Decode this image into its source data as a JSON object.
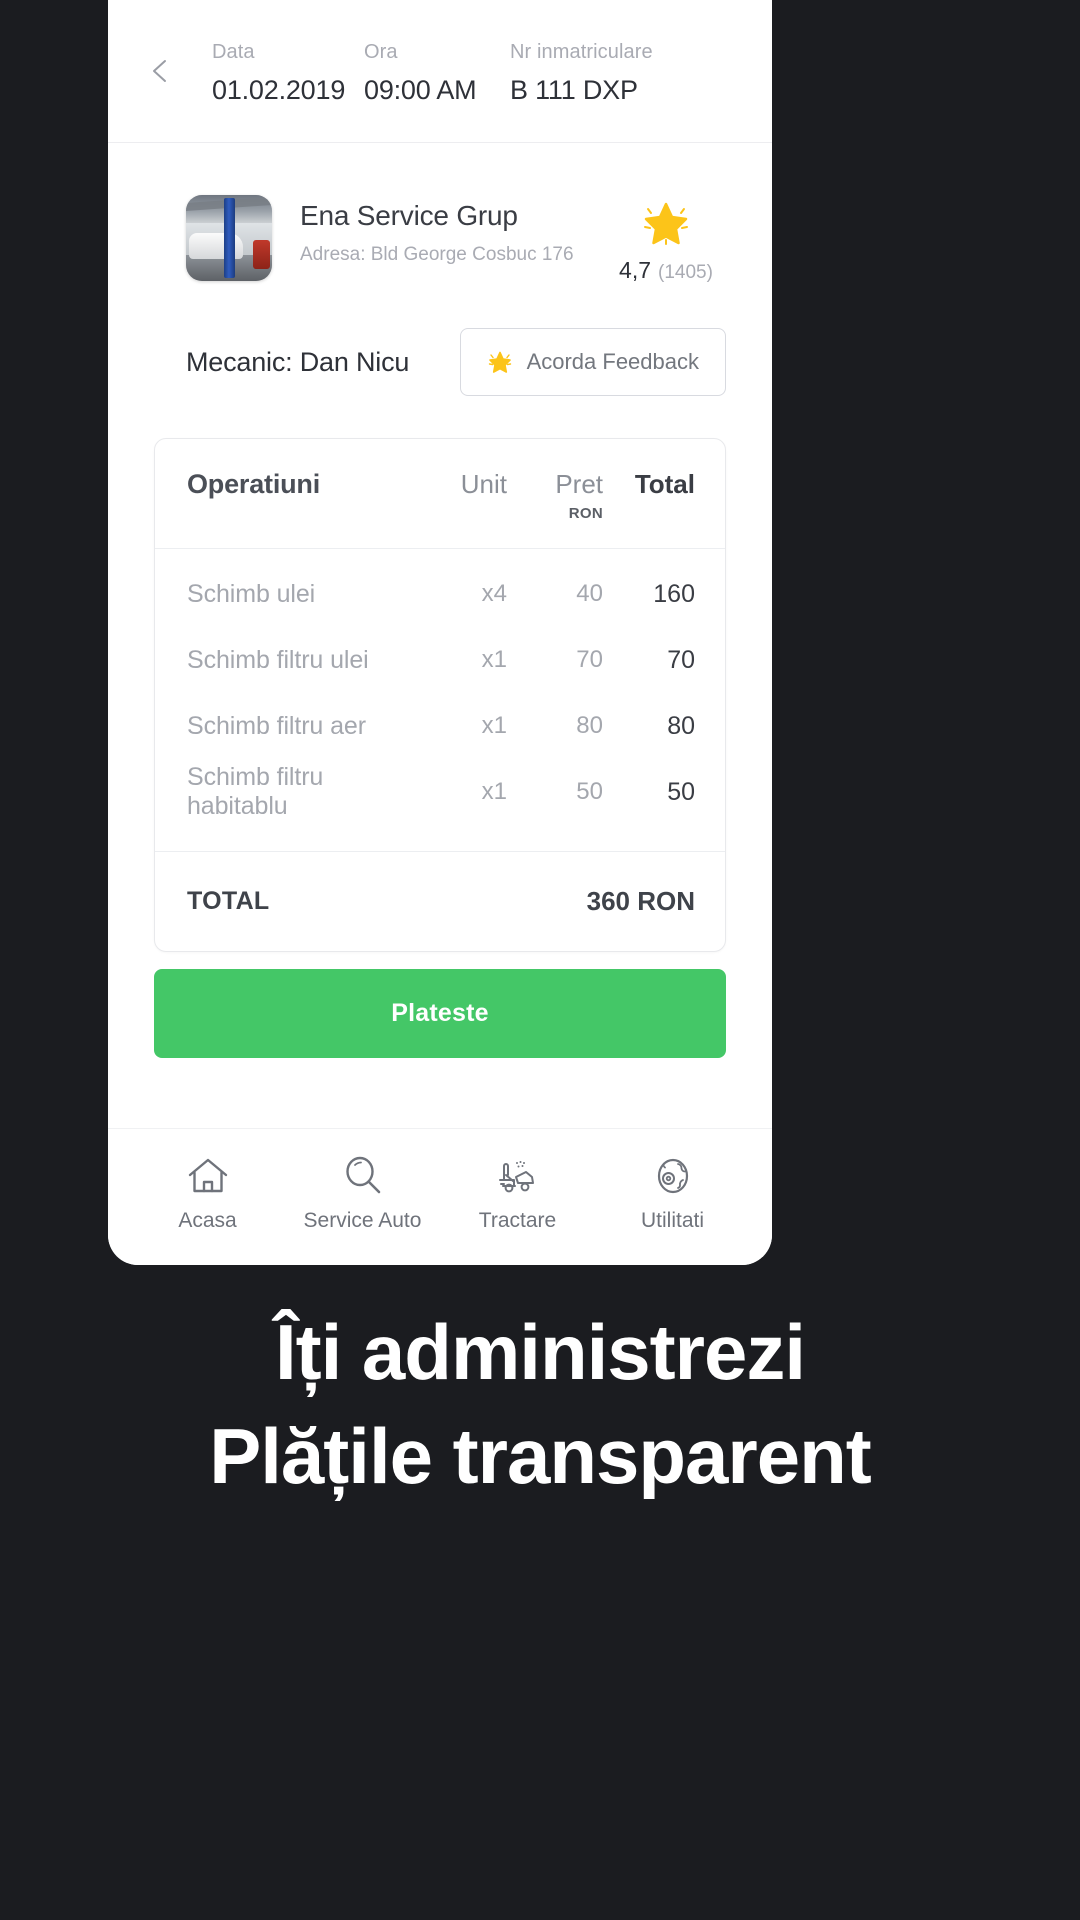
{
  "appointment": {
    "back_icon": "chevron-left-icon",
    "fields": [
      {
        "label": "Data",
        "value": "01.02.2019"
      },
      {
        "label": "Ora",
        "value": "09:00 AM"
      },
      {
        "label": "Nr inmatriculare",
        "value": "B 111 DXP"
      }
    ]
  },
  "provider": {
    "thumb_icon": "workshop-photo",
    "name": "Ena Service Grup",
    "address": "Adresa: Bld George Cosbuc 176",
    "rating": {
      "star_icon": "star-icon",
      "score": "4,7",
      "count": "(1405)"
    }
  },
  "mechanic": {
    "label": "Mecanic: Dan Nicu",
    "feedback_button": {
      "icon": "star-icon",
      "label": "Acorda Feedback"
    }
  },
  "operations": {
    "headers": {
      "name": "Operatiuni",
      "unit": "Unit",
      "price": "Pret",
      "currency": "RON",
      "total": "Total"
    },
    "rows": [
      {
        "name": "Schimb ulei",
        "unit": "x4",
        "price": "40",
        "total": "160"
      },
      {
        "name": "Schimb filtru ulei",
        "unit": "x1",
        "price": "70",
        "total": "70"
      },
      {
        "name": "Schimb filtru aer",
        "unit": "x1",
        "price": "80",
        "total": "80"
      },
      {
        "name": "Schimb filtru habitablu",
        "unit": "x1",
        "price": "50",
        "total": "50"
      }
    ],
    "total_label": "TOTAL",
    "total_value": "360 RON"
  },
  "pay_button": {
    "label": "Plateste",
    "color": "#44c767"
  },
  "bottom_nav": [
    {
      "icon": "home-icon",
      "label": "Acasa"
    },
    {
      "icon": "search-icon",
      "label": "Service Auto"
    },
    {
      "icon": "tow-truck-icon",
      "label": "Tractare"
    },
    {
      "icon": "globe-icon",
      "label": "Utilitati"
    }
  ],
  "caption": {
    "line1": "Îți administrezi",
    "line2": "Plățile transparent"
  }
}
